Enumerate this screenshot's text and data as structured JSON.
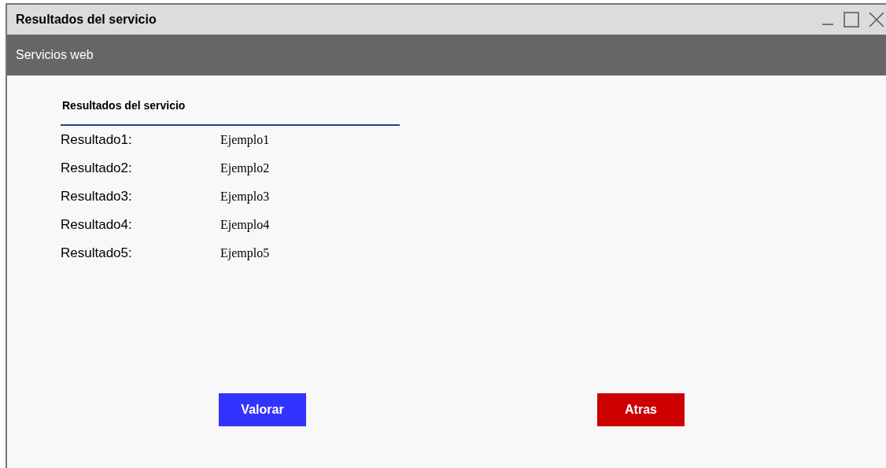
{
  "window": {
    "title": "Resultados del servicio"
  },
  "header": {
    "title": "Servicios web"
  },
  "section": {
    "title": "Resultados del servicio"
  },
  "results": [
    {
      "label": "Resultado1:",
      "value": "Ejemplo1"
    },
    {
      "label": "Resultado2:",
      "value": "Ejemplo2"
    },
    {
      "label": "Resultado3:",
      "value": "Ejemplo3"
    },
    {
      "label": "Resultado4:",
      "value": "Ejemplo4"
    },
    {
      "label": "Resultado5:",
      "value": "Ejemplo5"
    }
  ],
  "buttons": [
    {
      "label": "Valorar",
      "kind": "primary"
    },
    {
      "label": "Atras",
      "kind": "danger"
    }
  ]
}
